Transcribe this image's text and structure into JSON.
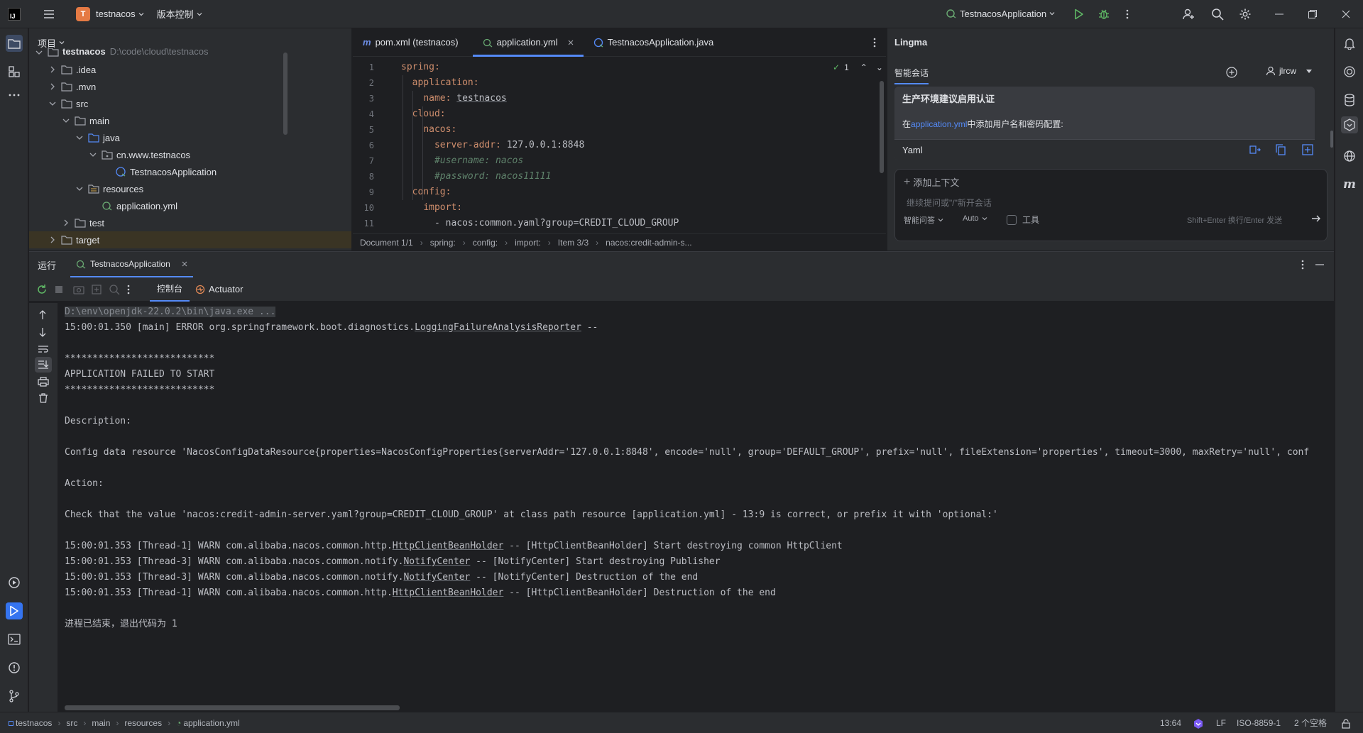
{
  "titlebar": {
    "project_initial": "T",
    "project_name": "testnacos",
    "vcs_label": "版本控制",
    "run_config": "TestnacosApplication"
  },
  "project_panel": {
    "title": "项目",
    "root": {
      "name": "testnacos",
      "path": "D:\\code\\cloud\\testnacos"
    },
    "items": [
      {
        "label": ".idea",
        "icon": "folder-icon"
      },
      {
        "label": ".mvn",
        "icon": "folder-icon"
      },
      {
        "label": "src",
        "icon": "folder-icon"
      },
      {
        "label": "main",
        "icon": "folder-icon"
      },
      {
        "label": "java",
        "icon": "source-folder-icon"
      },
      {
        "label": "cn.www.testnacos",
        "icon": "package-icon"
      },
      {
        "label": "TestnacosApplication",
        "icon": "spring-class-icon"
      },
      {
        "label": "resources",
        "icon": "resources-folder-icon"
      },
      {
        "label": "application.yml",
        "icon": "spring-yaml-icon"
      },
      {
        "label": "test",
        "icon": "folder-icon"
      },
      {
        "label": "target",
        "icon": "folder-icon"
      }
    ]
  },
  "editor": {
    "tabs": [
      {
        "label": "pom.xml (testnacos)",
        "icon": "maven-icon"
      },
      {
        "label": "application.yml",
        "icon": "spring-yaml-icon",
        "active": true
      },
      {
        "label": "TestnacosApplication.java",
        "icon": "spring-class-icon"
      }
    ],
    "inspection_count": "1",
    "line_numbers": [
      "1",
      "2",
      "3",
      "4",
      "5",
      "6",
      "7",
      "8",
      "9",
      "10",
      "11"
    ],
    "lines": [
      [
        {
          "t": "spring:",
          "c": "k"
        }
      ],
      [
        {
          "t": "  "
        },
        {
          "t": "application:",
          "c": "k"
        }
      ],
      [
        {
          "t": "    "
        },
        {
          "t": "name: ",
          "c": "k"
        },
        {
          "t": "testnacos",
          "c": "u"
        }
      ],
      [
        {
          "t": "  "
        },
        {
          "t": "cloud:",
          "c": "k"
        }
      ],
      [
        {
          "t": "    "
        },
        {
          "t": "nacos:",
          "c": "k"
        }
      ],
      [
        {
          "t": "      "
        },
        {
          "t": "server-addr: ",
          "c": "k"
        },
        {
          "t": "127.0.0.1:8848"
        }
      ],
      [
        {
          "t": "      "
        },
        {
          "t": "#username: nacos",
          "c": "cm"
        }
      ],
      [
        {
          "t": "      "
        },
        {
          "t": "#password: nacos11111",
          "c": "cm"
        }
      ],
      [
        {
          "t": "  "
        },
        {
          "t": "config:",
          "c": "k"
        }
      ],
      [
        {
          "t": "    "
        },
        {
          "t": "import:",
          "c": "k"
        }
      ],
      [
        {
          "t": "      - nacos:common.yaml?group=CREDIT_CLOUD_GROUP"
        }
      ]
    ],
    "breadcrumb": [
      "Document 1/1",
      "spring:",
      "config:",
      "import:",
      "Item 3/3",
      "nacos:credit-admin-s..."
    ]
  },
  "lingma": {
    "title": "Lingma",
    "tab": "智能会话",
    "user": "jlrcw",
    "card_title": "生产环境建议启用认证",
    "card_text_before": "在",
    "card_link": "application.yml",
    "card_text_after": "中添加用户名和密码配置:",
    "code_lang": "Yaml",
    "add_context": "添加上下文",
    "input_placeholder": "继续提问或\"/\"新开会话",
    "mode": "智能问答",
    "model": "Auto",
    "tools_label": "工具",
    "send_hint": "Shift+Enter 换行/Enter 发送"
  },
  "run": {
    "title": "运行",
    "tab": "TestnacosApplication",
    "console_tab": "控制台",
    "actuator_tab": "Actuator",
    "lines": [
      [
        {
          "t": "D:\\env\\openjdk-22.0.2\\bin\\java.exe ...",
          "c": "hl"
        }
      ],
      [
        {
          "t": "15:00:01.350 [main] ERROR org.springframework.boot.diagnostics."
        },
        {
          "t": "LoggingFailureAnalysisReporter",
          "c": "u"
        },
        {
          "t": " --"
        }
      ],
      [
        {
          "t": ""
        }
      ],
      [
        {
          "t": "***************************"
        }
      ],
      [
        {
          "t": "APPLICATION FAILED TO START"
        }
      ],
      [
        {
          "t": "***************************"
        }
      ],
      [
        {
          "t": ""
        }
      ],
      [
        {
          "t": "Description:"
        }
      ],
      [
        {
          "t": ""
        }
      ],
      [
        {
          "t": "Config data resource 'NacosConfigDataResource{properties=NacosConfigProperties{serverAddr='127.0.0.1:8848', encode='null', group='DEFAULT_GROUP', prefix='null', fileExtension='properties', timeout=3000, maxRetry='null', conf"
        }
      ],
      [
        {
          "t": ""
        }
      ],
      [
        {
          "t": "Action:"
        }
      ],
      [
        {
          "t": ""
        }
      ],
      [
        {
          "t": "Check that the value 'nacos:credit-admin-server.yaml?group=CREDIT_CLOUD_GROUP' at class path resource [application.yml] - 13:9 is correct, or prefix it with 'optional:'"
        }
      ],
      [
        {
          "t": ""
        }
      ],
      [
        {
          "t": "15:00:01.353 [Thread-1] WARN com.alibaba.nacos.common.http."
        },
        {
          "t": "HttpClientBeanHolder",
          "c": "u"
        },
        {
          "t": " -- [HttpClientBeanHolder] Start destroying common HttpClient"
        }
      ],
      [
        {
          "t": "15:00:01.353 [Thread-3] WARN com.alibaba.nacos.common.notify."
        },
        {
          "t": "NotifyCenter",
          "c": "u"
        },
        {
          "t": " -- [NotifyCenter] Start destroying Publisher"
        }
      ],
      [
        {
          "t": "15:00:01.353 [Thread-3] WARN com.alibaba.nacos.common.notify."
        },
        {
          "t": "NotifyCenter",
          "c": "u"
        },
        {
          "t": " -- [NotifyCenter] Destruction of the end"
        }
      ],
      [
        {
          "t": "15:00:01.353 [Thread-1] WARN com.alibaba.nacos.common.http."
        },
        {
          "t": "HttpClientBeanHolder",
          "c": "u"
        },
        {
          "t": " -- [HttpClientBeanHolder] Destruction of the end"
        }
      ],
      [
        {
          "t": ""
        }
      ],
      [
        {
          "t": "进程已结束，退出代码为 1"
        }
      ]
    ]
  },
  "statusbar": {
    "path": [
      "testnacos",
      "src",
      "main",
      "resources",
      "application.yml"
    ],
    "position": "13:64",
    "line_sep": "LF",
    "encoding": "ISO-8859-1",
    "indent": "2 个空格"
  },
  "colors": {
    "accent": "#548af7",
    "run_green": "#5fb865",
    "error_text": "#bcbec4"
  }
}
